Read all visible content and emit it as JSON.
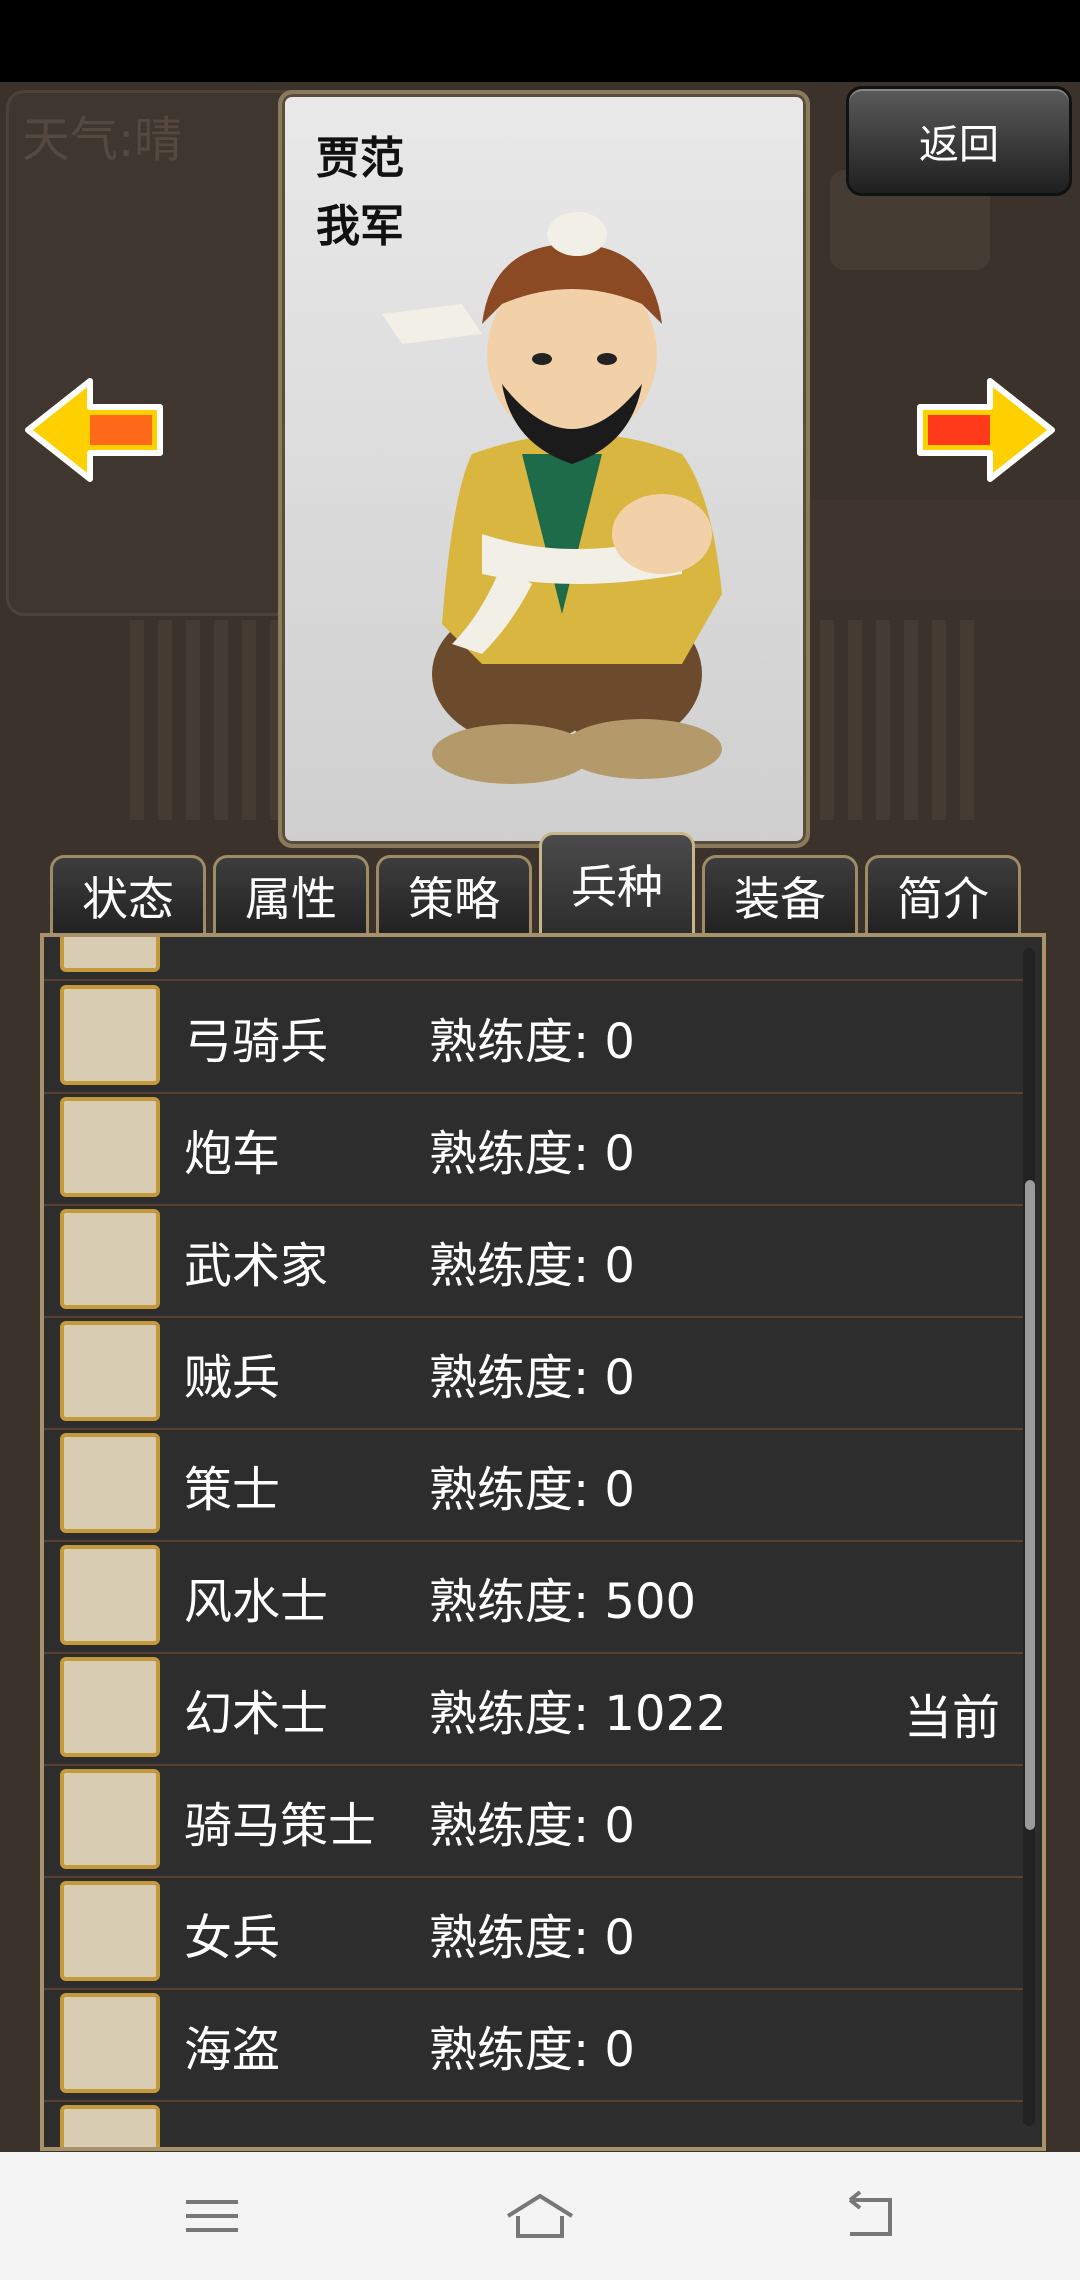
{
  "background": {
    "weather_text": "天气:晴"
  },
  "general": {
    "name": "贾范",
    "faction": "我军"
  },
  "header": {
    "back_label": "返回"
  },
  "tabs": [
    {
      "label": "状态",
      "active": false
    },
    {
      "label": "属性",
      "active": false
    },
    {
      "label": "策略",
      "active": false
    },
    {
      "label": "兵种",
      "active": true
    },
    {
      "label": "装备",
      "active": false
    },
    {
      "label": "简介",
      "active": false
    }
  ],
  "units": [
    {
      "name": "弓骑兵",
      "proficiency": "熟练度: 0",
      "status": "",
      "icon": "horse-archer-icon"
    },
    {
      "name": "炮车",
      "proficiency": "熟练度: 0",
      "status": "",
      "icon": "catapult-icon"
    },
    {
      "name": "武术家",
      "proficiency": "熟练度: 0",
      "status": "",
      "icon": "martial-artist-icon"
    },
    {
      "name": "贼兵",
      "proficiency": "熟练度: 0",
      "status": "",
      "icon": "bandit-icon"
    },
    {
      "name": "策士",
      "proficiency": "熟练度: 0",
      "status": "",
      "icon": "strategist-icon"
    },
    {
      "name": "风水士",
      "proficiency": "熟练度: 500",
      "status": "",
      "icon": "geomancer-icon"
    },
    {
      "name": "幻术士",
      "proficiency": "熟练度: 1022",
      "status": "当前",
      "icon": "illusionist-icon"
    },
    {
      "name": "骑马策士",
      "proficiency": "熟练度: 0",
      "status": "",
      "icon": "mounted-strategist-icon"
    },
    {
      "name": "女兵",
      "proficiency": "熟练度: 0",
      "status": "",
      "icon": "female-soldier-icon"
    },
    {
      "name": "海盗",
      "proficiency": "熟练度: 0",
      "status": "",
      "icon": "pirate-icon"
    }
  ],
  "colors": {
    "accent_gold": "#c59a3a",
    "panel_bg": "#2d2d2d",
    "row_divider": "#5a4030"
  }
}
